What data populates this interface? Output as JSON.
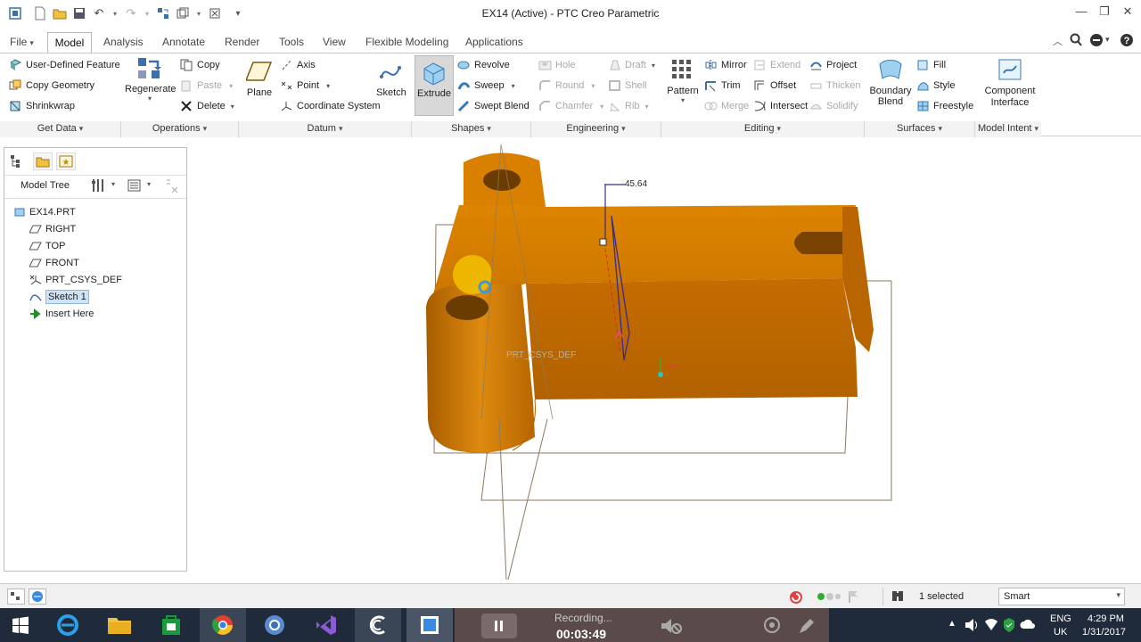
{
  "window": {
    "title": "EX14 (Active) - PTC Creo Parametric",
    "controls": [
      "minimize",
      "restore",
      "close"
    ]
  },
  "menu_tabs": [
    "File",
    "Model",
    "Analysis",
    "Annotate",
    "Render",
    "Tools",
    "View",
    "Flexible Modeling",
    "Applications"
  ],
  "active_tab": "Model",
  "ribbon": {
    "get_data": {
      "label": "Get Data",
      "items": [
        "User-Defined Feature",
        "Copy Geometry",
        "Shrinkwrap"
      ]
    },
    "operations": {
      "label": "Operations",
      "regenerate": "Regenerate",
      "items": [
        "Copy",
        "Paste",
        "Delete"
      ]
    },
    "datum": {
      "label": "Datum",
      "plane": "Plane",
      "items": [
        "Axis",
        "Point",
        "Coordinate System"
      ],
      "sketch": "Sketch"
    },
    "shapes": {
      "label": "Shapes",
      "extrude": "Extrude",
      "items": [
        "Revolve",
        "Sweep",
        "Swept Blend"
      ]
    },
    "engineering": {
      "label": "Engineering",
      "items": [
        "Hole",
        "Round",
        "Chamfer",
        "Draft",
        "Shell",
        "Rib"
      ]
    },
    "editing": {
      "label": "Editing",
      "pattern": "Pattern",
      "col1": [
        "Mirror",
        "Trim",
        "Merge"
      ],
      "col2": [
        "Extend",
        "Offset",
        "Intersect"
      ],
      "col3": [
        "Project",
        "Thicken",
        "Solidify"
      ]
    },
    "surfaces": {
      "label": "Surfaces",
      "boundary": "Boundary Blend",
      "items": [
        "Fill",
        "Style",
        "Freestyle"
      ]
    },
    "model_intent": {
      "label": "Model Intent",
      "component": "Component Interface"
    }
  },
  "model_tree": {
    "header": "Model Tree",
    "root": "EX14.PRT",
    "items": [
      "RIGHT",
      "TOP",
      "FRONT",
      "PRT_CSYS_DEF",
      "Sketch 1",
      "Insert Here"
    ],
    "selected": "Sketch 1"
  },
  "viewport": {
    "dimension": "45.64",
    "csys_label": "PRT_CSYS_DEF",
    "part_color": "#d97a00"
  },
  "status": {
    "selected": "1 selected",
    "filter": "Smart"
  },
  "taskbar": {
    "recording": "Recording...",
    "timer": "00:03:49",
    "lang": "ENG",
    "region": "UK",
    "time": "4:29 PM",
    "date": "1/31/2017"
  }
}
